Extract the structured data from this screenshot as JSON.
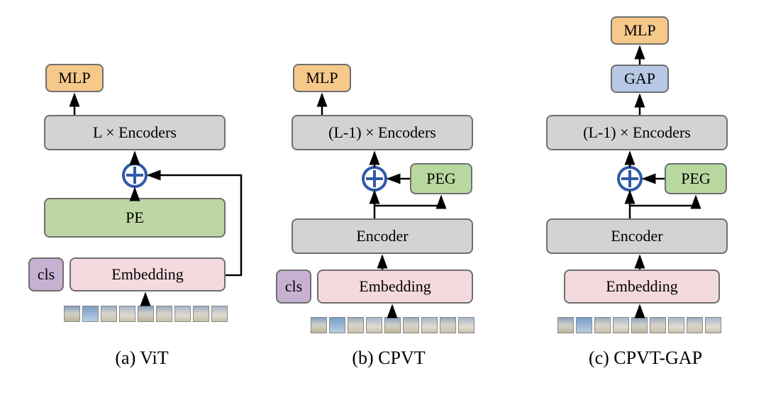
{
  "colors": {
    "mlp": "#f6c88a",
    "gap": "#b6c8e3",
    "encoder": "#d3d3d3",
    "encoder_border": "#6f6f6f",
    "pe": "#bdd6a4",
    "peg": "#b9d89f",
    "cls": "#c7b1d1",
    "embedding": "#f4d9de",
    "plus_fill": "#ffffff",
    "plus_stroke": "#2f5aa8",
    "arrow": "#000000"
  },
  "labels": {
    "mlp": "MLP",
    "gap": "GAP",
    "encoders_L": "L × Encoders",
    "encoders_Lm1": "(L-1) × Encoders",
    "pe": "PE",
    "peg": "PEG",
    "cls": "cls",
    "embedding": "Embedding",
    "encoder": "Encoder"
  },
  "captions": {
    "a": "(a)  ViT",
    "b": "(b)  CPVT",
    "c": "(c)  CPVT-GAP"
  },
  "architectures": {
    "ViT": [
      "image-patches",
      "cls+Embedding",
      "PE  ⊕  (skip from Embedding)",
      "L × Encoders",
      "MLP"
    ],
    "CPVT": [
      "image-patches",
      "cls+Embedding",
      "Encoder",
      "⊕  ← PEG  (residual on Encoder output)",
      "(L-1) × Encoders",
      "MLP"
    ],
    "CPVT-GAP": [
      "image-patches",
      "Embedding",
      "Encoder",
      "⊕  ← PEG  (residual on Encoder output)",
      "(L-1) × Encoders",
      "GAP",
      "MLP"
    ]
  }
}
